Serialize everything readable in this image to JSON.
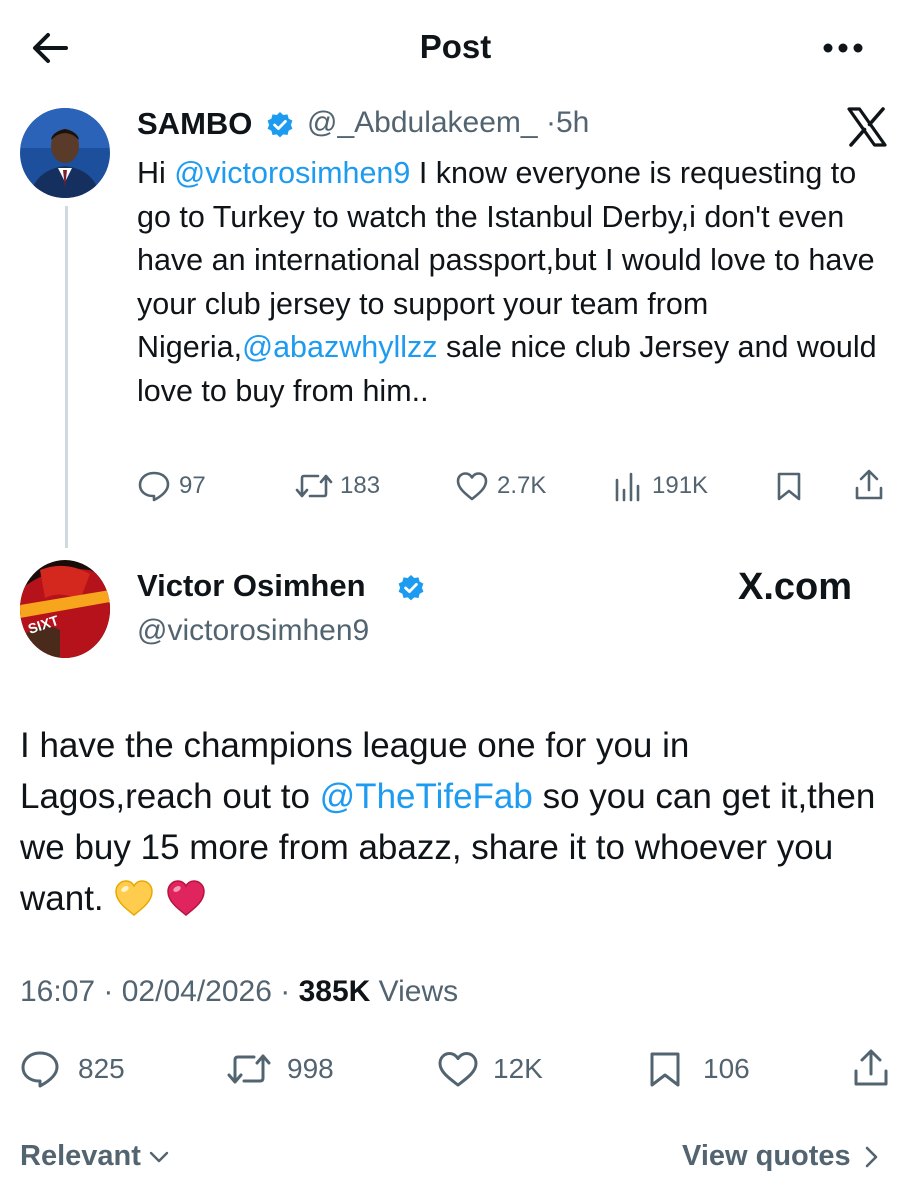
{
  "header": {
    "title": "Post"
  },
  "quoted_tweet": {
    "name": "SAMBO",
    "handle": "@_Abdulakeem_",
    "dot": "·",
    "time": "5h",
    "text_parts": [
      {
        "text": "Hi ",
        "link": false
      },
      {
        "text": "@victorosimhen9",
        "link": true
      },
      {
        "text": " I know everyone is requesting to go to Turkey to watch the Istanbul Derby,i don't even have an international passport,but I would love to have your club jersey to support your team from Nigeria,",
        "link": false
      },
      {
        "text": "@abazwhyllzz",
        "link": true
      },
      {
        "text": " sale nice club Jersey and would love to buy from him..",
        "link": false
      }
    ],
    "stats": {
      "replies": "97",
      "reposts": "183",
      "likes": "2.7K",
      "views": "191K"
    }
  },
  "main_tweet": {
    "name": "Victor Osimhen",
    "handle": "@victorosimhen9",
    "watermark": "X.com",
    "text_parts": [
      {
        "text": "I have the champions league one for you in Lagos,reach out to ",
        "link": false
      },
      {
        "text": "@TheTifeFab",
        "link": true
      },
      {
        "text": " so you can get it,then we buy 15 more from abazz, share it to whoever you want.",
        "link": false
      }
    ],
    "time": "16:07",
    "date": "02/04/2026",
    "views_count": "385K",
    "views_label": "Views",
    "stats": {
      "replies": "825",
      "reposts": "998",
      "likes": "12K",
      "bookmarks": "106"
    }
  },
  "footer": {
    "sort_label": "Relevant",
    "view_quotes_label": "View quotes"
  },
  "colors": {
    "link": "#1d9bf0",
    "secondary": "#536471",
    "verified": "#1d9bf0",
    "heart_red": "#e0245e",
    "heart_yellow": "#ffcc4d"
  },
  "icons": {
    "back": "arrow-left-icon",
    "more": "more-dots-icon",
    "verified": "verified-badge-icon",
    "x_logo": "x-logo-icon",
    "reply": "reply-icon",
    "repost": "repost-icon",
    "like": "heart-icon",
    "views": "views-bar-icon",
    "bookmark": "bookmark-icon",
    "share": "share-icon",
    "chevron_down": "chevron-down-icon",
    "chevron_right": "chevron-right-icon"
  }
}
